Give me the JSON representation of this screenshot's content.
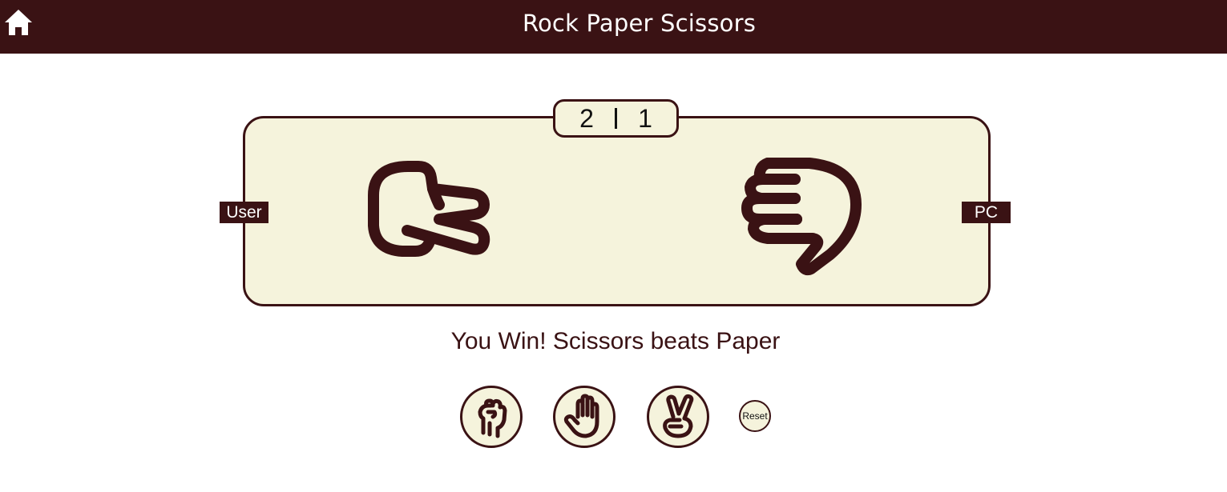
{
  "header": {
    "title": "Rock Paper Scissors",
    "home_icon": "home-icon",
    "background_color": "#3a1214"
  },
  "score": {
    "user": "2",
    "pc": "1"
  },
  "players": {
    "user_label": "User",
    "pc_label": "PC",
    "user_choice_icon": "scissors-hand-icon",
    "pc_choice_icon": "paper-hand-icon"
  },
  "result": {
    "message": "You Win! Scissors beats Paper"
  },
  "controls": {
    "rock_icon": "rock-hand-icon",
    "paper_icon": "paper-hand-icon",
    "scissors_icon": "scissors-hand-icon",
    "reset_label": "Reset"
  },
  "colors": {
    "accent": "#3a1214",
    "panel": "#f5f3dc"
  }
}
